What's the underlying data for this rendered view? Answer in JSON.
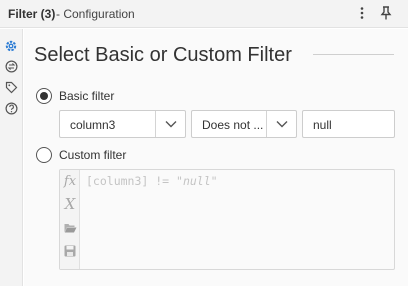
{
  "titlebar": {
    "title": "Filter (3)",
    "subtitle": "- Configuration",
    "more_icon": "more-vertical-icon",
    "pin_icon": "pin-icon"
  },
  "rail": {
    "icons": [
      "gear-icon",
      "connection-icon",
      "tag-icon",
      "help-icon"
    ],
    "active_color": "#2a7bd4"
  },
  "main": {
    "heading": "Select Basic or Custom Filter",
    "basic": {
      "label": "Basic filter",
      "selected": true,
      "column_value": "column3",
      "operator_value": "Does not ...",
      "operand_value": "null"
    },
    "custom": {
      "label": "Custom filter",
      "selected": false,
      "expression_field": "[column3]",
      "expression_op": " != ",
      "expression_literal": "\"null\"",
      "tools": [
        "fx-icon",
        "variable-x-icon",
        "open-folder-icon",
        "save-icon"
      ]
    }
  }
}
